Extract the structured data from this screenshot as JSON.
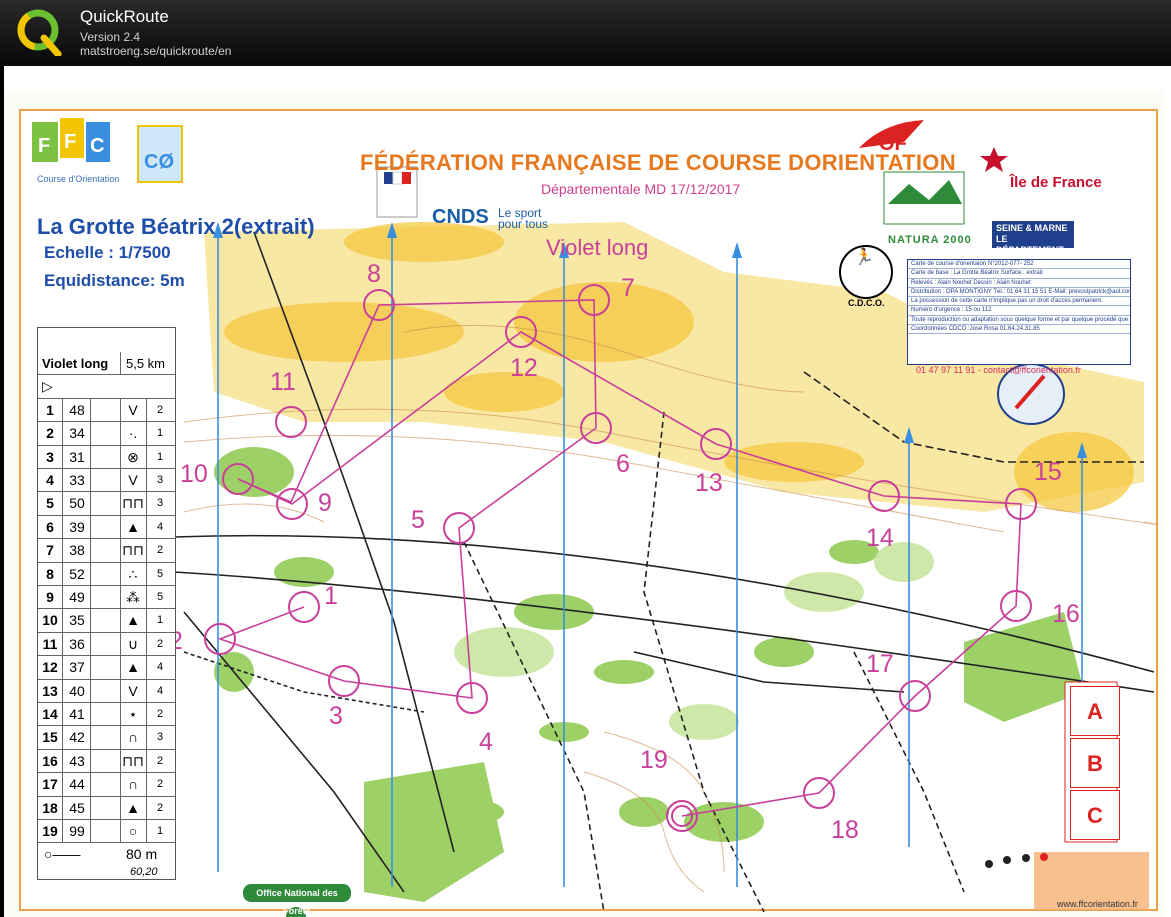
{
  "app": {
    "name": "QuickRoute",
    "version": "Version 2.4",
    "url": "matstroeng.se/quickroute/en"
  },
  "map": {
    "header_title": "FÉDÉRATION FRANÇAISE DE COURSE DORIENTATION",
    "header_subtitle": "Départementale MD 17/12/2017",
    "course_title": "La Grotte Béatrix 2(extrait)",
    "scale": "Echelle : 1/7500",
    "equidistance": "Equidistance: 5m",
    "class_name": "Violet long",
    "logos": {
      "ffco_sub": "Course d'Orientation",
      "cnds": "CNDS",
      "cnds_tagline_1": "Le sport",
      "cnds_tagline_2": "pour tous",
      "ile_de_france": "Île de France",
      "natura": "NATURA 2000",
      "seine_marne_1": "SEINE & MARNE",
      "seine_marne_2": "LE DÉPARTEMENT",
      "cdco": "C.D.C.O.",
      "onf": "Office National des Forêts",
      "ffco_url": "www.ffcorientation.fr"
    },
    "info_box": [
      "Carte de course d'orientaion N°2012-077- 252",
      "Carte de base : La Grotte Béatrix          Surface : extrait",
      "Relevés : Alain Nouhet          Dessin : Alain Nouhet",
      "Distribution : OPA MONTIGNY  Tél.: 01 64 31 15 51  E-Mail: prevostpatrick@aol.com",
      "La possession de cette carte n'implique pas un droit d'accès permanent.",
      "Numéro d'urgence : 15 ou 112",
      "Toute reproduction ou adaptation sous quelque forme et par quelque procédé que ce soit, même partielle, est interdite.",
      "Coordonnées CDCO :José Rosa          01.64.24.31.85"
    ],
    "contact": "01 47 97 11 91 - contact@ffcorientation.fr",
    "abc_boxes": [
      "A",
      "B",
      "C"
    ],
    "controls": [
      "1",
      "2",
      "3",
      "4",
      "5",
      "6",
      "7",
      "8",
      "9",
      "10",
      "11",
      "12",
      "13",
      "14",
      "15",
      "16",
      "17",
      "18",
      "19"
    ]
  },
  "description_sheet": {
    "class": "Violet long",
    "distance": "5,5 km",
    "rows": [
      {
        "n": "1",
        "code": "48",
        "sym": "V",
        "last": "2"
      },
      {
        "n": "2",
        "code": "34",
        "sym": "·.",
        "last": "1"
      },
      {
        "n": "3",
        "code": "31",
        "sym": "⊗",
        "last": "1"
      },
      {
        "n": "4",
        "code": "33",
        "sym": "V",
        "last": "3"
      },
      {
        "n": "5",
        "code": "50",
        "sym": "⊓⊓",
        "last": "3"
      },
      {
        "n": "6",
        "code": "39",
        "sym": "▲",
        "last": "4"
      },
      {
        "n": "7",
        "code": "38",
        "sym": "⊓⊓",
        "last": "2"
      },
      {
        "n": "8",
        "code": "52",
        "sym": "∴",
        "last": "5"
      },
      {
        "n": "9",
        "code": "49",
        "sym": "⁂",
        "last": "5"
      },
      {
        "n": "10",
        "code": "35",
        "sym": "▲",
        "last": "1"
      },
      {
        "n": "11",
        "code": "36",
        "sym": "∪",
        "last": "2"
      },
      {
        "n": "12",
        "code": "37",
        "sym": "▲",
        "last": "4"
      },
      {
        "n": "13",
        "code": "40",
        "sym": "V",
        "last": "4"
      },
      {
        "n": "14",
        "code": "41",
        "sym": "⋆",
        "last": "2"
      },
      {
        "n": "15",
        "code": "42",
        "sym": "∩",
        "last": "3"
      },
      {
        "n": "16",
        "code": "43",
        "sym": "⊓⊓",
        "last": "2"
      },
      {
        "n": "17",
        "code": "44",
        "sym": "∩",
        "last": "2"
      },
      {
        "n": "18",
        "code": "45",
        "sym": "▲",
        "last": "2"
      },
      {
        "n": "19",
        "code": "99",
        "sym": "○",
        "last": "1"
      }
    ],
    "finish_distance": "80 m",
    "handwritten_note": "60,20"
  },
  "colors": {
    "control": "#c8409a",
    "ffco_orange": "#e6781e",
    "title_blue": "#1e4ea8",
    "vegetation_green": "#7dc242",
    "rough_yellow": "#f7d55a"
  }
}
